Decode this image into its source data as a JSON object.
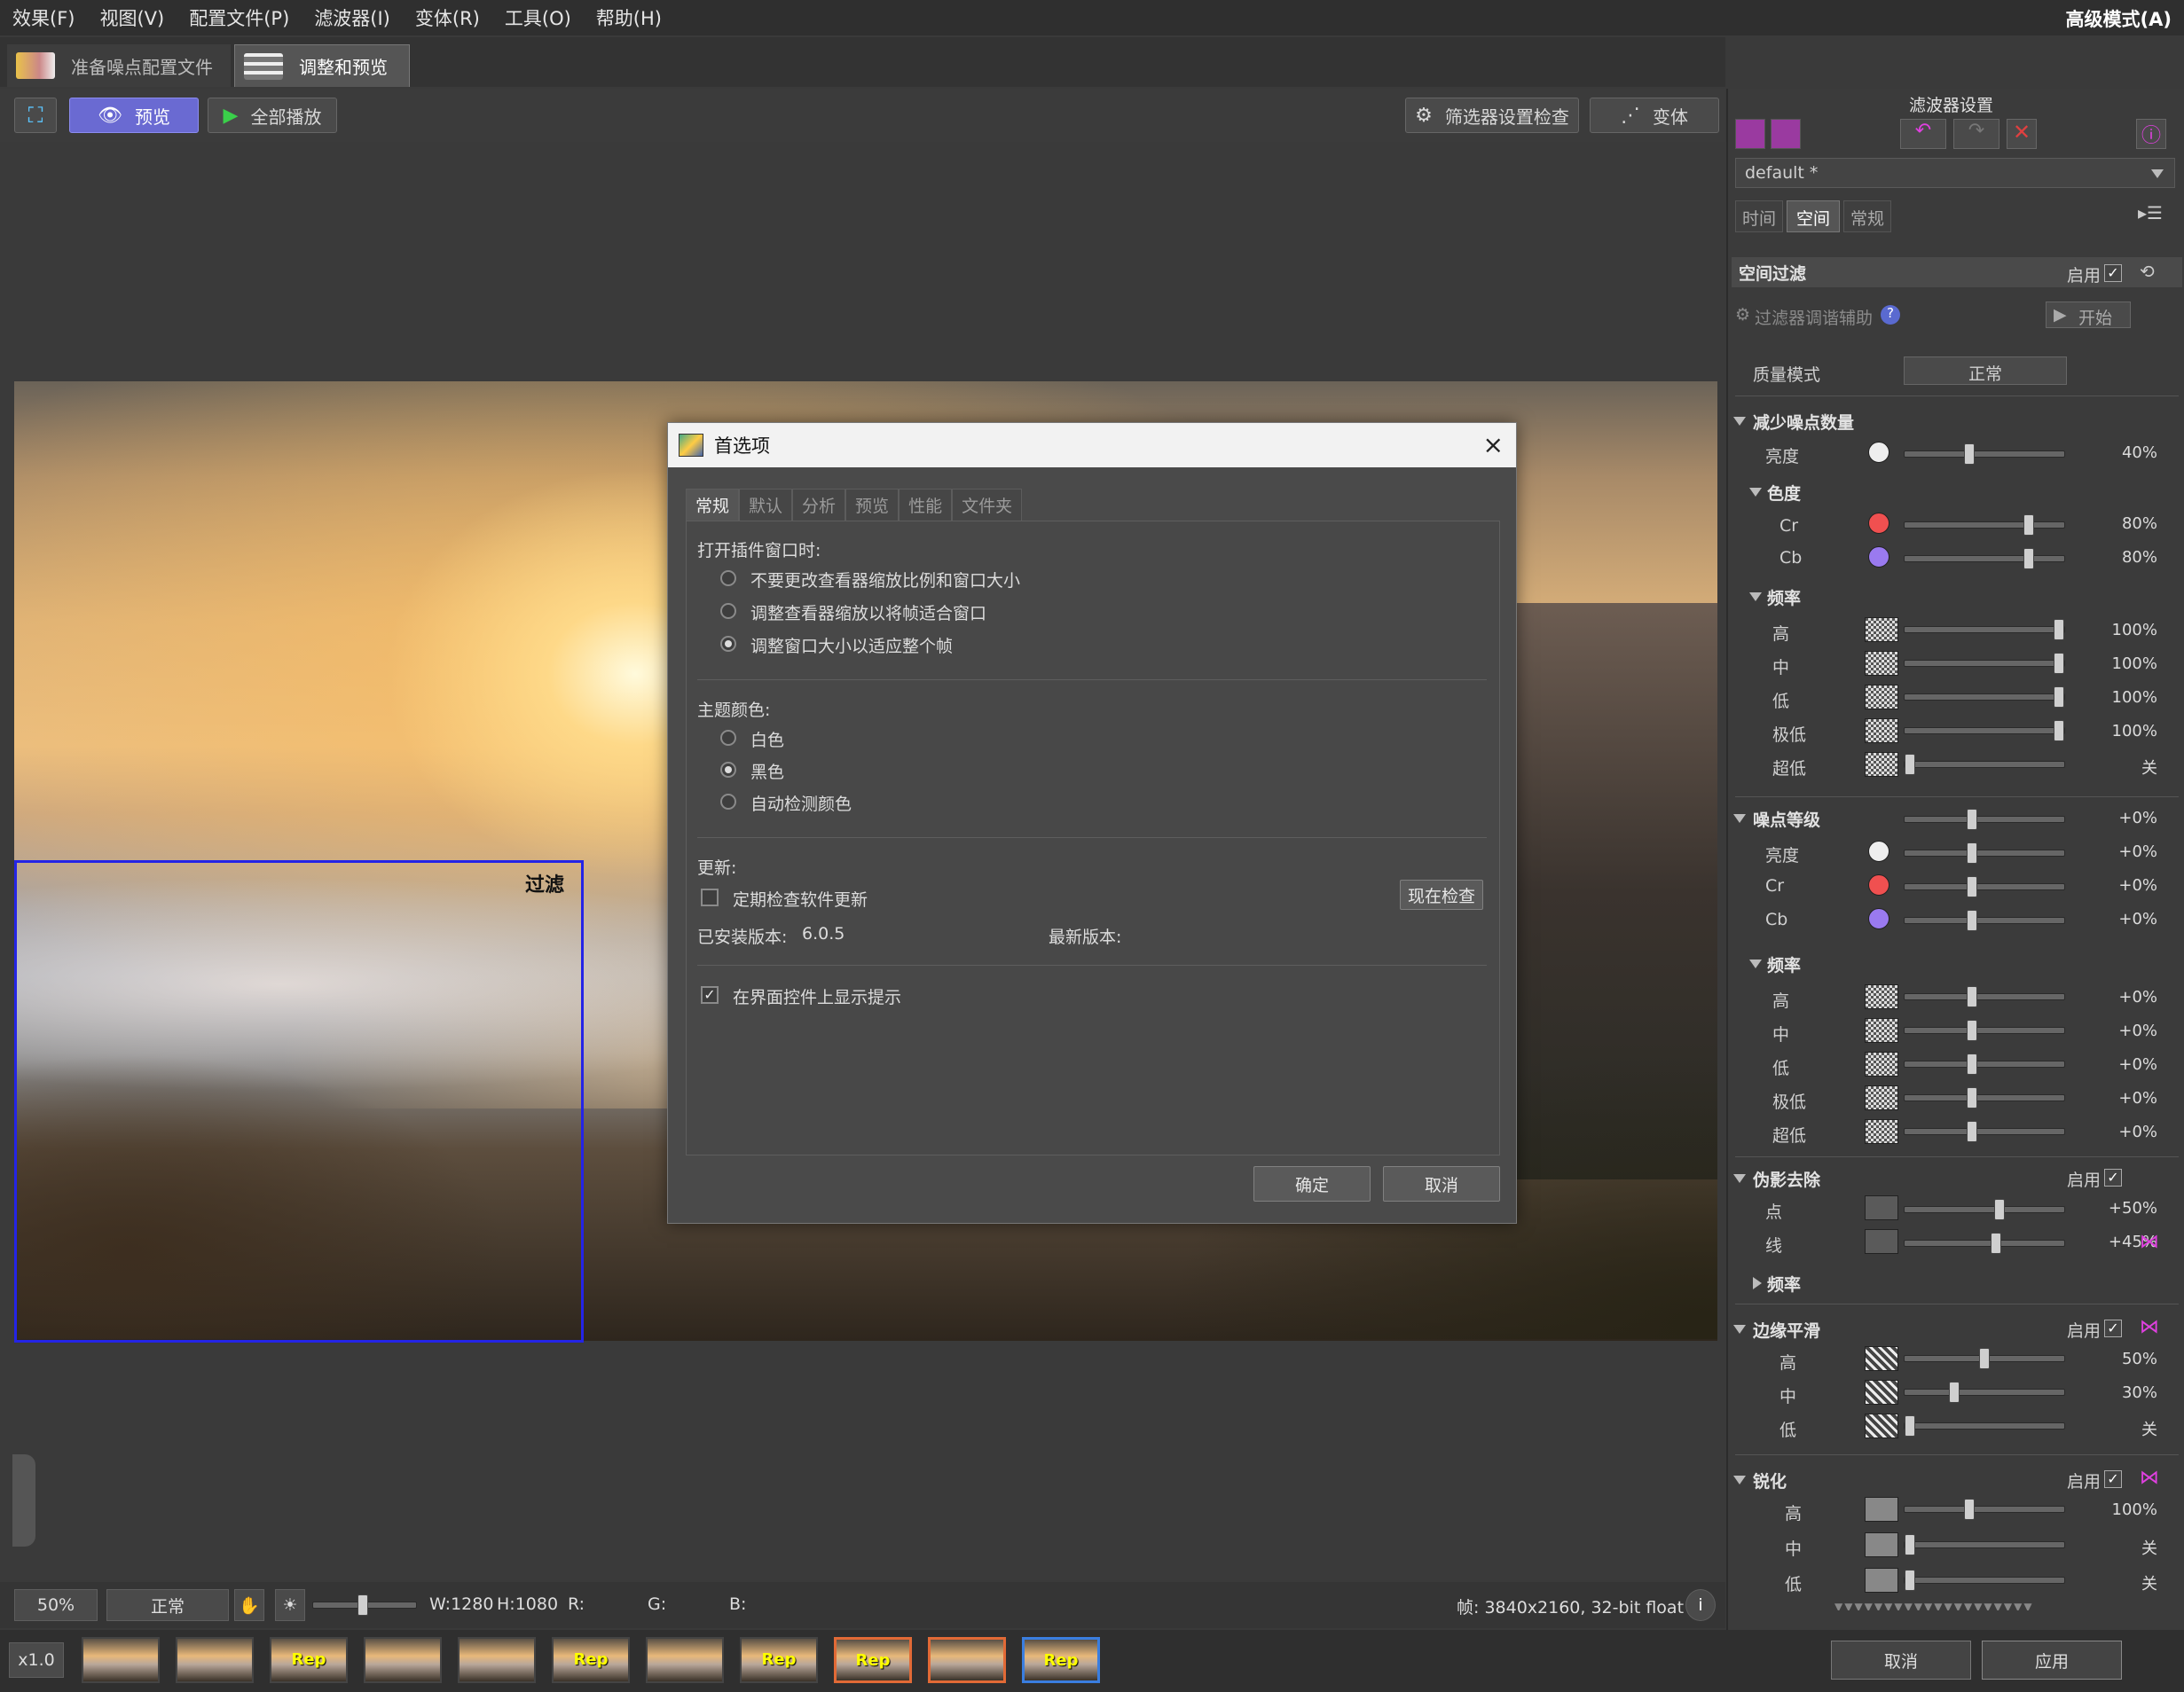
{
  "menu": {
    "items": [
      "效果(F)",
      "视图(V)",
      "配置文件(P)",
      "滤波器(I)",
      "变体(R)",
      "工具(O)",
      "帮助(H)"
    ],
    "mode": "高级模式(A)"
  },
  "tabs": {
    "prepare": "准备噪点配置文件",
    "adjust": "调整和预览"
  },
  "toolbar": {
    "preview": "预览",
    "play_all": "全部播放",
    "filter_check": "筛选器设置检查",
    "variant": "变体"
  },
  "viewer": {
    "roi_label": "过滤"
  },
  "dialog": {
    "title": "首选项",
    "close": "×",
    "tabs": [
      "常规",
      "默认",
      "分析",
      "预览",
      "性能",
      "文件夹"
    ],
    "open_section": "打开插件窗口时:",
    "open_options": [
      "不要更改查看器缩放比例和窗口大小",
      "调整查看器缩放以将帧适合窗口",
      "调整窗口大小以适应整个帧"
    ],
    "open_selected": 2,
    "theme_section": "主题颜色:",
    "theme_options": [
      "白色",
      "黑色",
      "自动检测颜色"
    ],
    "theme_selected": 1,
    "update_section": "更新:",
    "auto_check": "定期检查软件更新",
    "auto_check_on": false,
    "check_now": "现在检查",
    "installed_label": "已安装版本:",
    "installed_version": "6.0.5",
    "latest_label": "最新版本:",
    "tooltips": "在界面控件上显示提示",
    "tooltips_on": true,
    "ok": "确定",
    "cancel": "取消"
  },
  "panel": {
    "title": "滤波器设置",
    "profile": "default *",
    "tabs": [
      "时间",
      "空间",
      "常规"
    ],
    "active_tab": 1,
    "spatial": "空间过滤",
    "enable": "启用",
    "assist": "过滤器调谐辅助",
    "start": "开始",
    "quality_label": "质量模式",
    "quality_value": "正常",
    "nr_amount": "减少噪点数量",
    "nr_luma": {
      "label": "亮度",
      "value": "40%",
      "level": 0.4
    },
    "chroma": "色度",
    "nr_cr": {
      "label": "Cr",
      "value": "80%",
      "level": 0.8
    },
    "nr_cb": {
      "label": "Cb",
      "value": "80%",
      "level": 0.8
    },
    "freq": "频率",
    "nr_freq": [
      {
        "label": "高",
        "value": "100%",
        "level": 1.0
      },
      {
        "label": "中",
        "value": "100%",
        "level": 1.0
      },
      {
        "label": "低",
        "value": "100%",
        "level": 1.0
      },
      {
        "label": "极低",
        "value": "100%",
        "level": 1.0
      },
      {
        "label": "超低",
        "value": "关",
        "level": 0.0
      }
    ],
    "noise_level": "噪点等级",
    "noise_level_value": "+0%",
    "nl_rows": [
      {
        "label": "亮度",
        "value": "+0%"
      },
      {
        "label": "Cr",
        "value": "+0%"
      },
      {
        "label": "Cb",
        "value": "+0%"
      }
    ],
    "nl_freq": [
      {
        "label": "高",
        "value": "+0%"
      },
      {
        "label": "中",
        "value": "+0%"
      },
      {
        "label": "低",
        "value": "+0%"
      },
      {
        "label": "极低",
        "value": "+0%"
      },
      {
        "label": "超低",
        "value": "+0%"
      }
    ],
    "artifact": "伪影去除",
    "art_dot": {
      "label": "点",
      "value": "+50%",
      "level": 0.6
    },
    "art_line": {
      "label": "线",
      "value": "+45%",
      "level": 0.58
    },
    "edge": "边缘平滑",
    "edge_rows": [
      {
        "label": "高",
        "value": "50%",
        "level": 0.5
      },
      {
        "label": "中",
        "value": "30%",
        "level": 0.3
      },
      {
        "label": "低",
        "value": "关",
        "level": 0.0
      }
    ],
    "sharpen": "锐化",
    "sharp_rows": [
      {
        "label": "高",
        "value": "100%",
        "level": 0.4
      },
      {
        "label": "中",
        "value": "关",
        "level": 0.0
      },
      {
        "label": "低",
        "value": "关",
        "level": 0.0
      }
    ]
  },
  "status": {
    "zoom": "50%",
    "mode": "正常",
    "w": "W:1280",
    "h": "H:1080",
    "r": "R:",
    "g": "G:",
    "b": "B:",
    "frame": "帧: 3840x2160, 32-bit float"
  },
  "filmstrip": {
    "speed": "x1.0",
    "rep": "Rep",
    "cancel": "取消",
    "apply": "应用"
  },
  "colors": {
    "accent": "#6a6ad2",
    "roi": "#2424e6",
    "thumb_orange": "#e26a36",
    "thumb_blue": "#3a7ee0"
  }
}
